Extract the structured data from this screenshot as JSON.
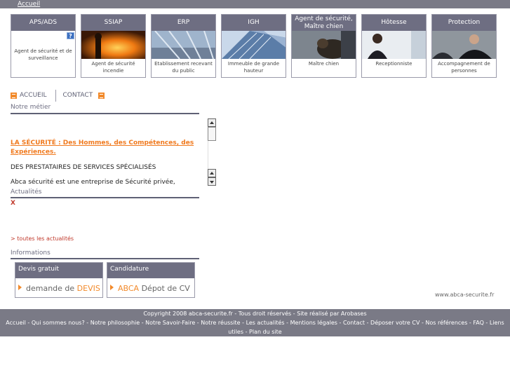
{
  "topbar": {
    "home_link": "Accueil"
  },
  "cards": [
    {
      "title": "APS/ADS",
      "caption": "Agent de sécurité et de surveillance",
      "image": "none"
    },
    {
      "title": "SSIAP",
      "caption": "Agent de sécurité incendie",
      "image": "fire"
    },
    {
      "title": "ERP",
      "caption": "Etablissement recevant du public",
      "image": "building-hall"
    },
    {
      "title": "IGH",
      "caption": "Immeuble de grande hauteur",
      "image": "tower"
    },
    {
      "title": "Agent de sécurité, Maître chien",
      "caption": "Maître chien",
      "image": "dog"
    },
    {
      "title": "Hôtesse",
      "caption": "Receptionniste",
      "image": "hostess"
    },
    {
      "title": "Protection",
      "caption": "Accompagnement de personnes",
      "image": "bodyguard"
    }
  ],
  "help_badge": "?",
  "subnav": {
    "home": "ACCUEIL",
    "contact": "CONTACT"
  },
  "metier": {
    "title": "Notre métier",
    "headline": "LA SÉCURITÉ : Des Hommes, des Compétences, des Expériences.",
    "para1": "DES PRESTATAIRES DE SERVICES SPÉCIALISÉS",
    "para2": "Abca sécurité est une entreprise de Sécurité privée, prestataire de"
  },
  "news": {
    "title": "Actualités",
    "close": "X",
    "all_link": "> toutes les actualités"
  },
  "info": {
    "title": "Informations",
    "boxes": [
      {
        "title": "Devis gratuit",
        "text_pre": "demande de ",
        "text_hl": "DEVIS",
        "text_post": ""
      },
      {
        "title": "Candidature",
        "text_pre": "",
        "text_hl": "ABCA",
        "text_post": " Dépot de CV"
      }
    ]
  },
  "site_url": "www.abca-securite.fr",
  "footer": {
    "copyright": "Copyright 2008 abca-securite.fr - Tous droit réservés - Site réalisé par Arobases",
    "links": [
      "Accueil",
      "Qui sommes nous?",
      "Notre philosophie",
      "Notre Savoir-Faire",
      "Notre réussite",
      "Les actualités",
      "Mentions légales",
      "Contact",
      "Déposer votre CV",
      "Nos références",
      "FAQ",
      "Liens utiles",
      "Plan du site"
    ]
  },
  "colors": {
    "nav_bg": "#6e6e82",
    "accent": "#f28a2b",
    "link_red": "#c0392b"
  }
}
